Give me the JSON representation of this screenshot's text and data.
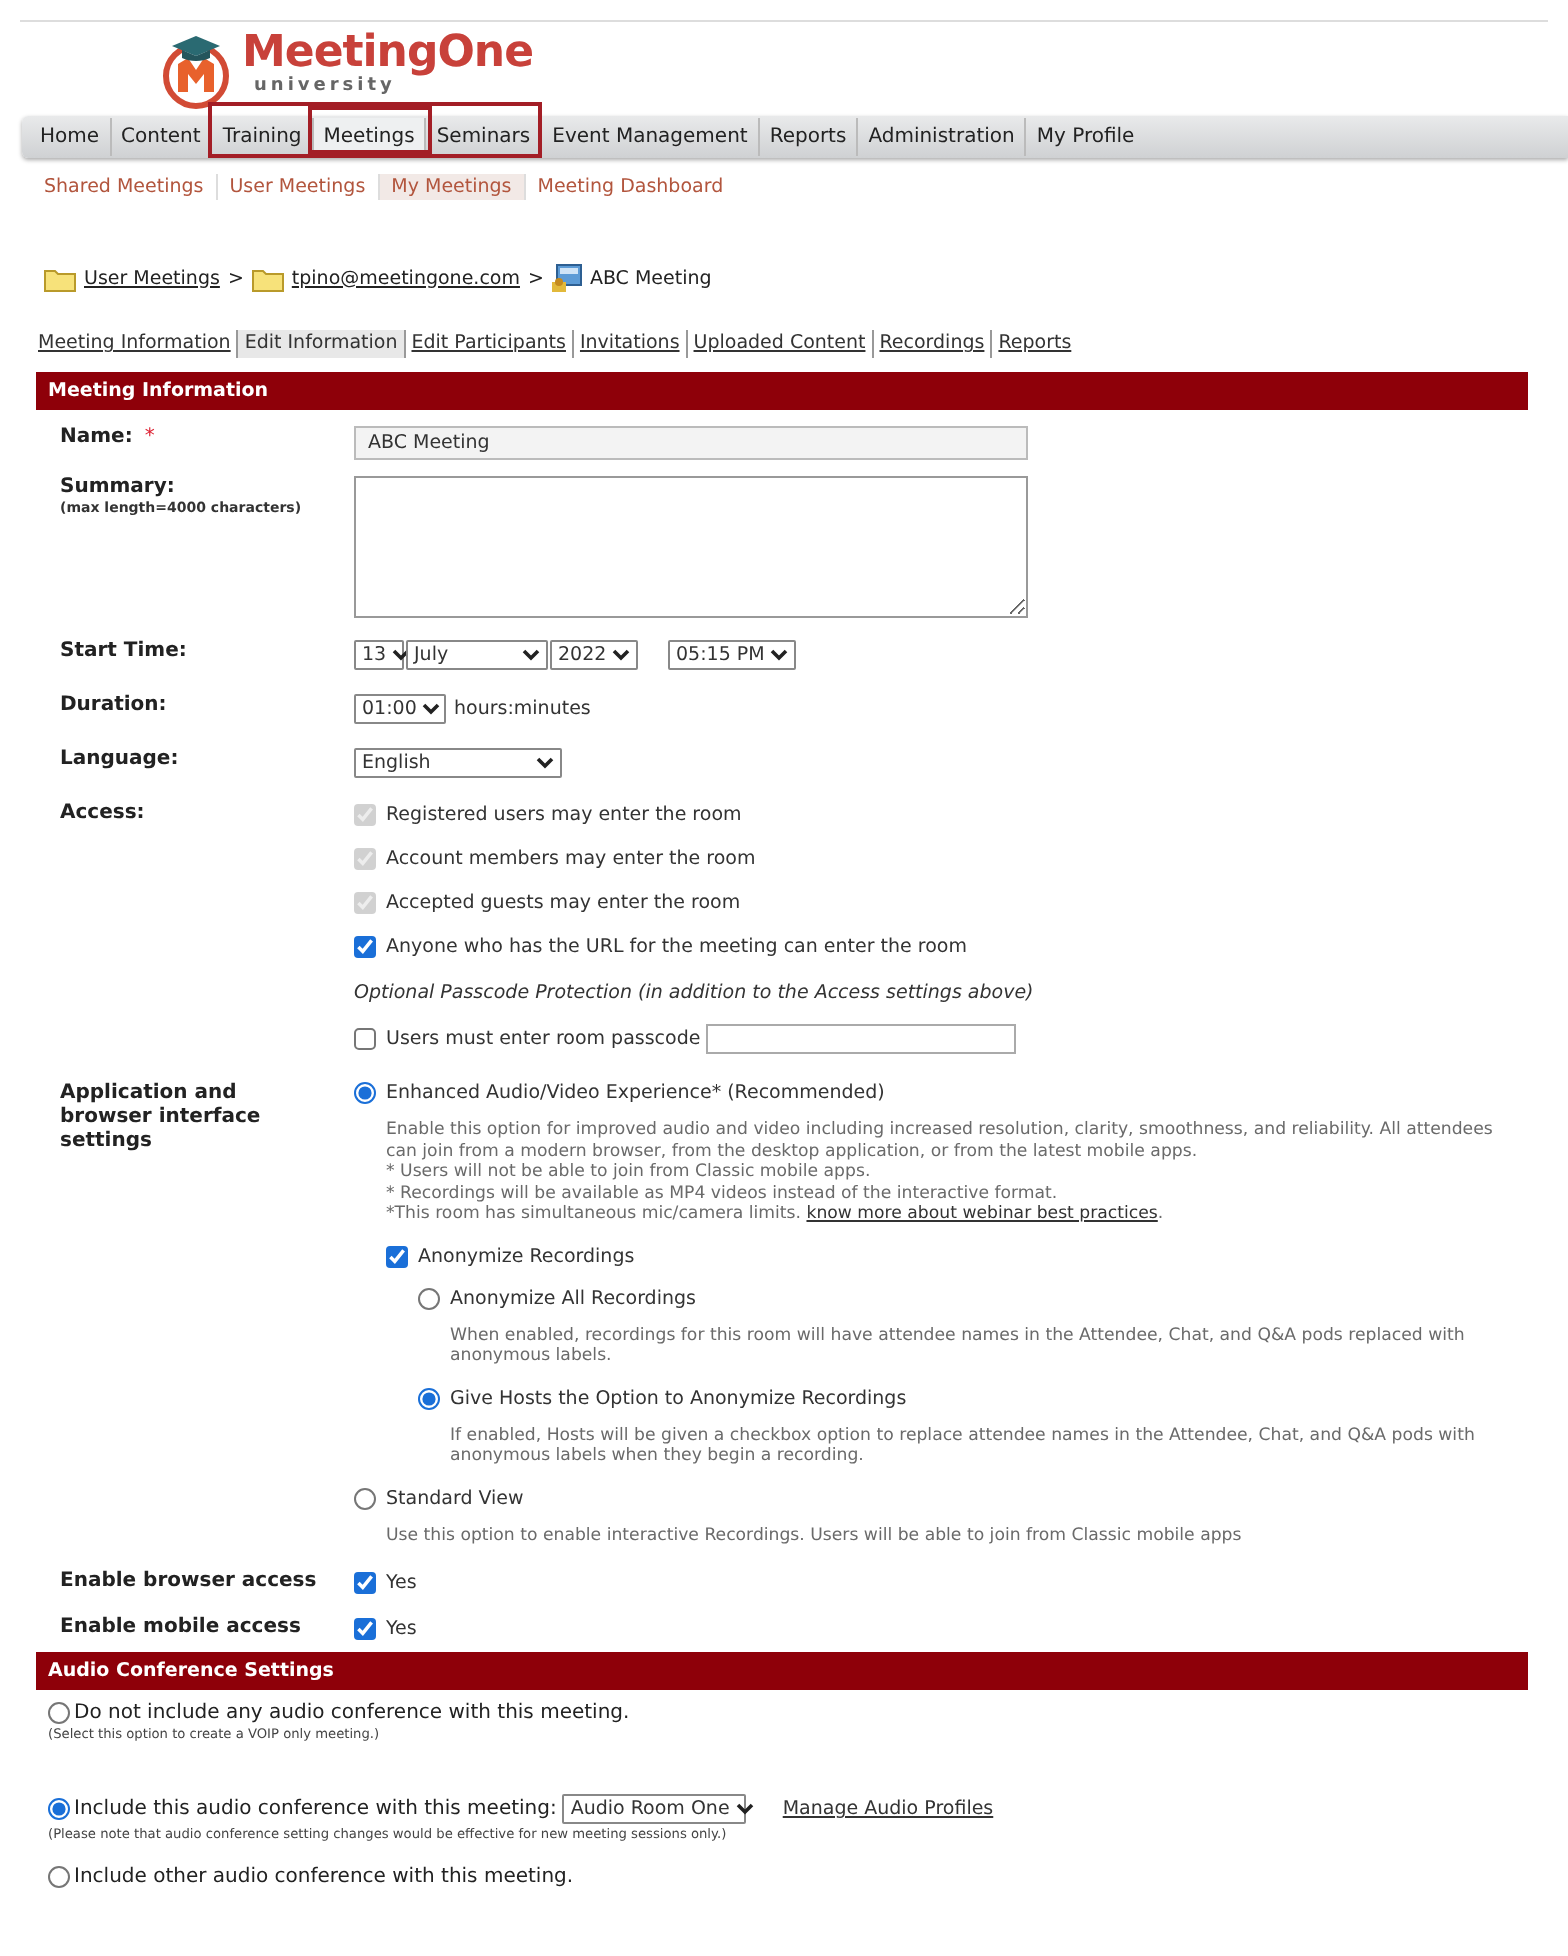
{
  "logo": {
    "name": "MeetingOne",
    "tagline": "university"
  },
  "nav": {
    "items": [
      {
        "label": "Home",
        "selected": false,
        "outlined": false
      },
      {
        "label": "Content",
        "selected": false,
        "outlined": false
      },
      {
        "label": "Training",
        "selected": false,
        "outlined": true
      },
      {
        "label": "Meetings",
        "selected": true,
        "outlined": true
      },
      {
        "label": "Seminars",
        "selected": false,
        "outlined": true
      },
      {
        "label": "Event Management",
        "selected": false,
        "outlined": false
      },
      {
        "label": "Reports",
        "selected": false,
        "outlined": false
      },
      {
        "label": "Administration",
        "selected": false,
        "outlined": false
      },
      {
        "label": "My Profile",
        "selected": false,
        "outlined": false
      }
    ]
  },
  "subnav": {
    "items": [
      {
        "label": "Shared Meetings",
        "selected": false
      },
      {
        "label": "User Meetings",
        "selected": false
      },
      {
        "label": "My Meetings",
        "selected": true
      },
      {
        "label": "Meeting Dashboard",
        "selected": false
      }
    ]
  },
  "breadcrumb": {
    "separator": ">",
    "items": [
      {
        "label": "User Meetings",
        "kind": "folder"
      },
      {
        "label": "tpino@meetingone.com",
        "kind": "folder"
      },
      {
        "label": "ABC Meeting",
        "kind": "meeting"
      }
    ]
  },
  "page_tabs": {
    "items": [
      {
        "label": "Meeting Information",
        "selected": false
      },
      {
        "label": "Edit Information",
        "selected": true
      },
      {
        "label": "Edit Participants",
        "selected": false
      },
      {
        "label": "Invitations",
        "selected": false
      },
      {
        "label": "Uploaded Content",
        "selected": false
      },
      {
        "label": "Recordings",
        "selected": false
      },
      {
        "label": "Reports",
        "selected": false
      }
    ]
  },
  "meeting_information": {
    "title": "Meeting Information",
    "name": {
      "label": "Name:",
      "required_mark": "*",
      "value": "ABC Meeting"
    },
    "summary": {
      "label": "Summary:",
      "hint": "(max length=4000 characters)"
    },
    "start_time": {
      "label": "Start Time:",
      "day": "13",
      "month": "July",
      "year": "2022",
      "time": "05:15 PM"
    },
    "duration": {
      "label": "Duration:",
      "value": "01:00",
      "unit": "hours:minutes"
    },
    "language": {
      "label": "Language:",
      "value": "English"
    },
    "access": {
      "label": "Access:",
      "options": [
        {
          "label": "Registered users may enter the room",
          "checked": true,
          "disabled": true
        },
        {
          "label": "Account members may enter the room",
          "checked": true,
          "disabled": true
        },
        {
          "label": "Accepted guests may enter the room",
          "checked": true,
          "disabled": true
        },
        {
          "label": "Anyone who has the URL for the meeting can enter the room",
          "checked": true,
          "disabled": false
        }
      ],
      "passcode_note": "Optional Passcode Protection (in addition to the Access settings above)",
      "passcode": {
        "label": "Users must enter room passcode",
        "checked": false
      }
    },
    "interface": {
      "label": "Application and browser interface settings",
      "options": [
        {
          "label": "Enhanced Audio/Video Experience* (Recommended)",
          "selected": true,
          "description": [
            "Enable this option for improved audio and video including increased resolution, clarity, smoothness, and reliability. All attendees can join from a modern browser, from the desktop application, or from the latest mobile apps.",
            "* Users will not be able to join from Classic mobile apps.",
            "* Recordings will be available as MP4 videos instead of the interactive format."
          ],
          "limits_note": "*This room has simultaneous mic/camera limits.",
          "link": "know more about webinar best practices",
          "link_suffix": ".",
          "anonymize": {
            "label": "Anonymize Recordings",
            "checked": true,
            "options": [
              {
                "label": "Anonymize All Recordings",
                "selected": false,
                "description": "When enabled, recordings for this room will have attendee names in the Attendee, Chat, and Q&A pods replaced with anonymous labels."
              },
              {
                "label": "Give Hosts the Option to Anonymize Recordings",
                "selected": true,
                "description": "If enabled, Hosts will be given a checkbox option to replace attendee names in the Attendee, Chat, and Q&A pods with anonymous labels when they begin a recording."
              }
            ]
          }
        },
        {
          "label": "Standard View",
          "selected": false,
          "description": [
            "Use this option to enable interactive Recordings. Users will be able to join from Classic mobile apps"
          ]
        }
      ]
    },
    "browser_access": {
      "label": "Enable browser access",
      "value": "Yes",
      "checked": true
    },
    "mobile_access": {
      "label": "Enable mobile access",
      "value": "Yes",
      "checked": true
    }
  },
  "audio_conference": {
    "title": "Audio Conference Settings",
    "options": [
      {
        "label": "Do not include any audio conference with this meeting.",
        "note": "(Select this option to create a VOIP only meeting.)",
        "selected": false
      },
      {
        "label": "Include this audio conference with this meeting:",
        "profile": "Audio Room One",
        "link": "Manage Audio Profiles",
        "note": "(Please note that audio conference setting changes would be effective for new meeting sessions only.)",
        "selected": true
      },
      {
        "label": "Include other audio conference with this meeting.",
        "selected": false
      }
    ]
  }
}
